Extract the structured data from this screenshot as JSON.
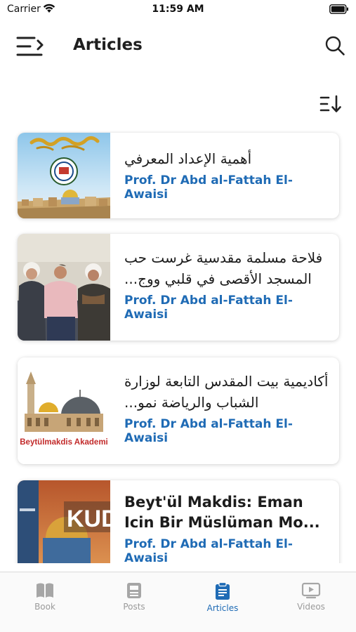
{
  "status_bar": {
    "carrier": "Carrier",
    "time": "11:59 AM"
  },
  "header": {
    "title": "Articles"
  },
  "articles": [
    {
      "title": "أهمية الإعداد المعرفي",
      "author": "Prof. Dr Abd al-Fattah El-Awaisi"
    },
    {
      "title": "فلاحة مسلمة مقدسية غرست حب المسجد الأقصى في قلبي ووج...",
      "author": "Prof. Dr Abd al-Fattah El-Awaisi"
    },
    {
      "title": "أكاديمية بيت المقدس التابعة لوزارة الشباب والرياضة نمو...",
      "author": "Prof. Dr Abd al-Fattah El-Awaisi",
      "thumb_caption": "Beytülmakdis Akademi"
    },
    {
      "title": "Beyt'ül Makdis: Eman Icin Bir Müslüman Mo...",
      "author": "Prof. Dr Abd al-Fattah El-Awaisi",
      "thumb_caption": "KUD"
    }
  ],
  "tabs": [
    {
      "label": "Book",
      "icon": "book-icon",
      "active": false
    },
    {
      "label": "Posts",
      "icon": "posts-icon",
      "active": false
    },
    {
      "label": "Articles",
      "icon": "clipboard-icon",
      "active": true
    },
    {
      "label": "Videos",
      "icon": "video-icon",
      "active": false
    }
  ],
  "colors": {
    "accent": "#1f6bb5",
    "inactive": "#9a9a9a",
    "text": "#1c1c1c"
  }
}
